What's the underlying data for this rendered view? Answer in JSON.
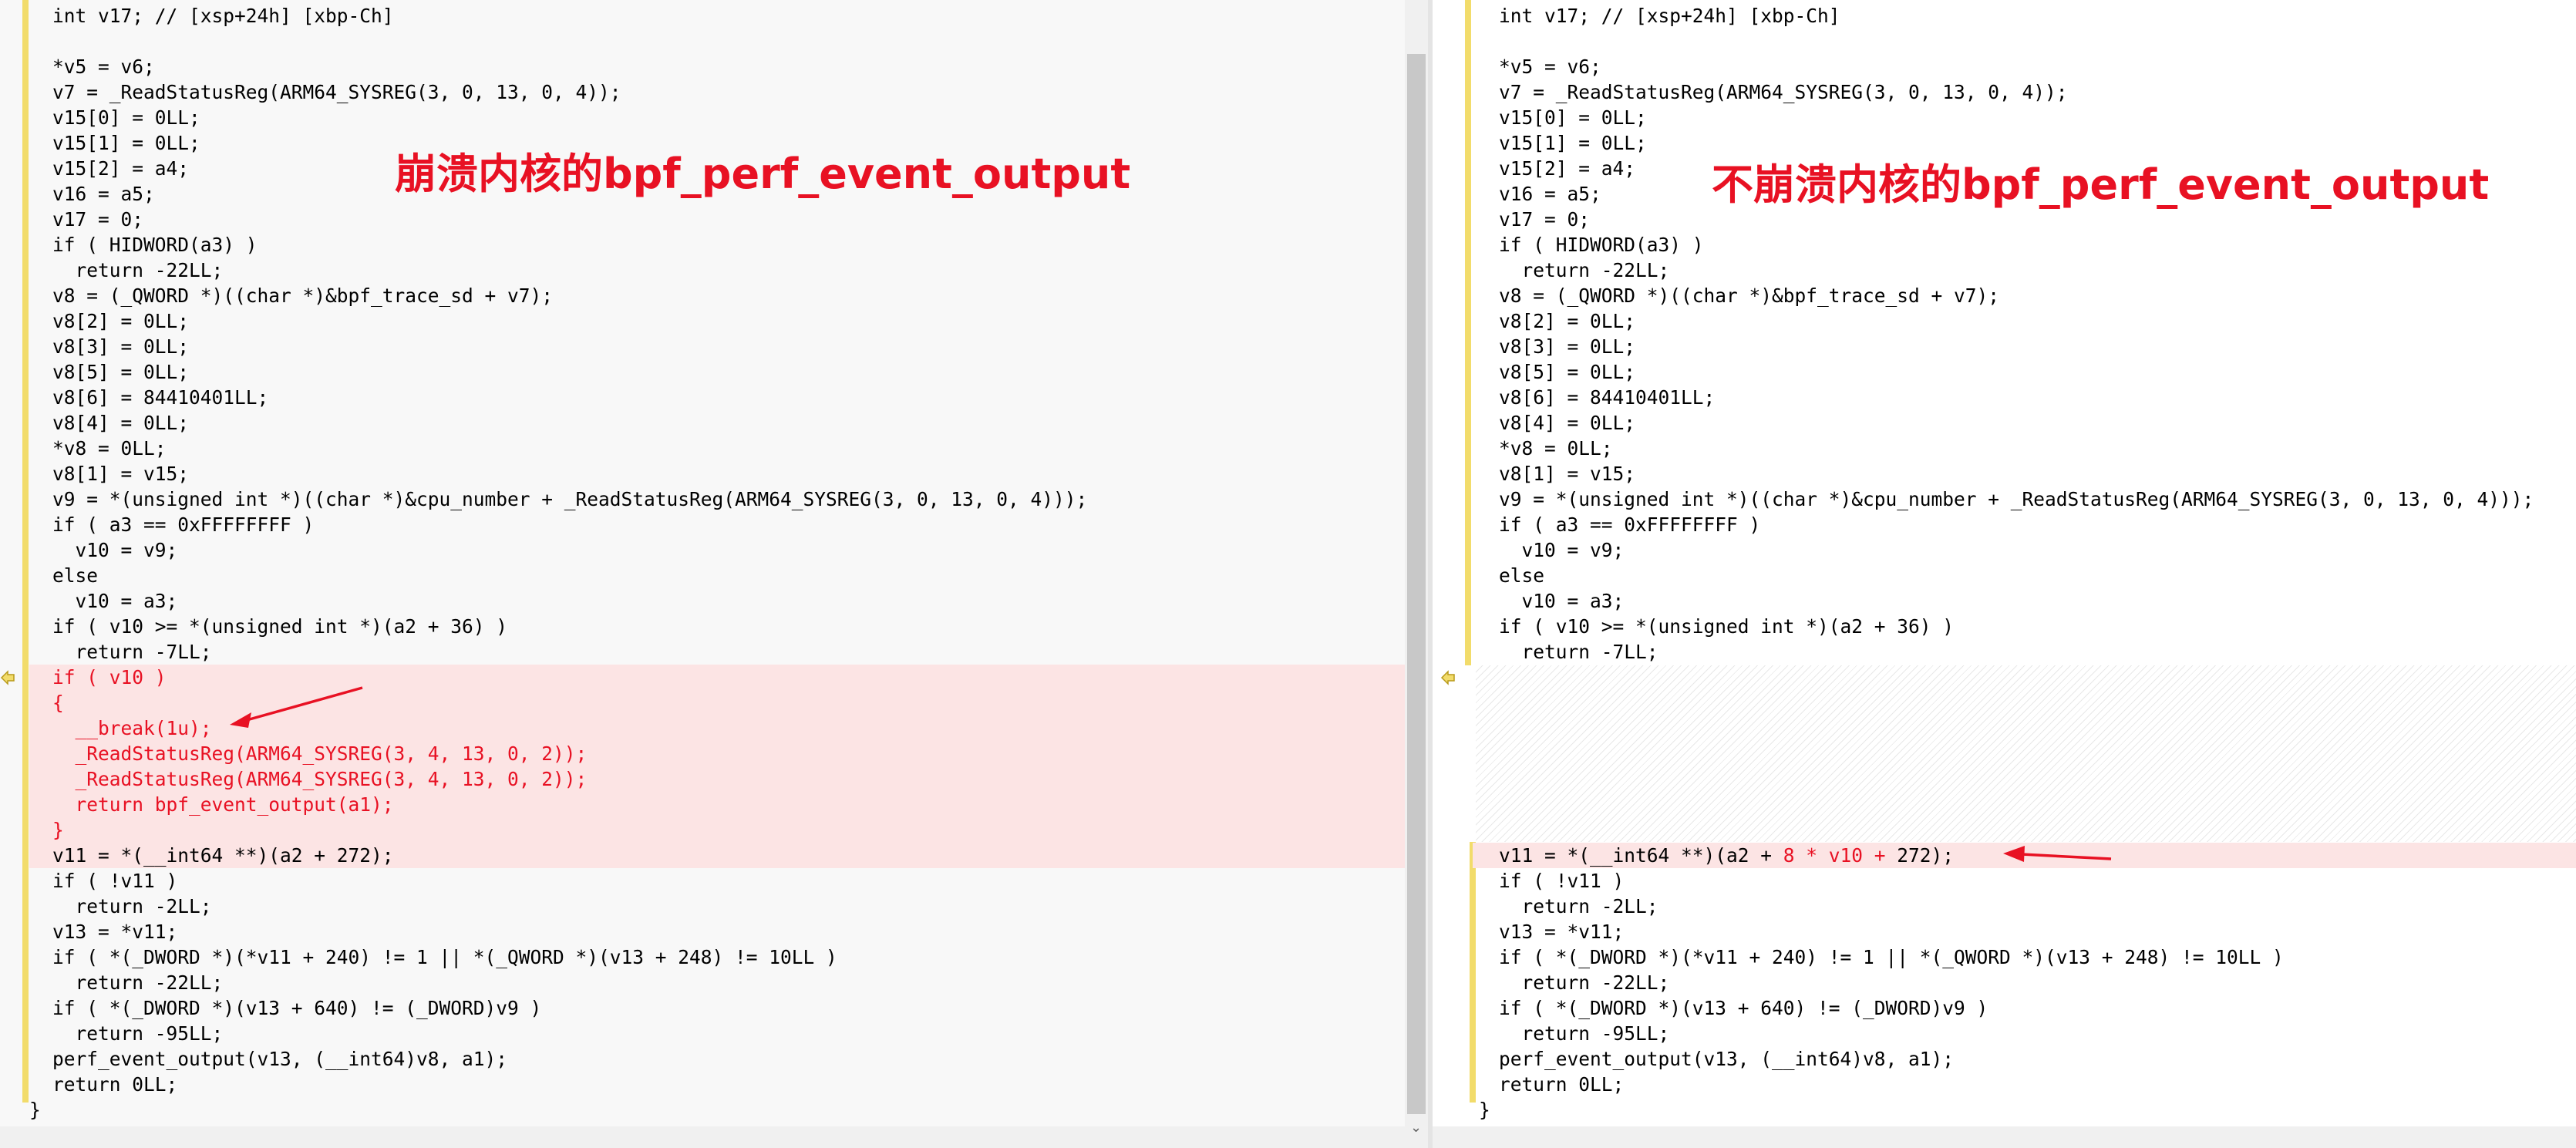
{
  "left_pane": {
    "annotation": "崩溃内核的bpf_perf_event_output",
    "lines": [
      {
        "text": "int v17; // [xsp+24h] [xbp-Ch]",
        "type": "normal"
      },
      {
        "text": "",
        "type": "normal"
      },
      {
        "text": "*v5 = v6;",
        "type": "normal"
      },
      {
        "text": "v7 = _ReadStatusReg(ARM64_SYSREG(3, 0, 13, 0, 4));",
        "type": "normal"
      },
      {
        "text": "v15[0] = 0LL;",
        "type": "normal"
      },
      {
        "text": "v15[1] = 0LL;",
        "type": "normal"
      },
      {
        "text": "v15[2] = a4;",
        "type": "normal"
      },
      {
        "text": "v16 = a5;",
        "type": "normal"
      },
      {
        "text": "v17 = 0;",
        "type": "normal"
      },
      {
        "text": "if ( HIDWORD(a3) )",
        "type": "normal"
      },
      {
        "text": "  return -22LL;",
        "type": "normal"
      },
      {
        "text": "v8 = (_QWORD *)((char *)&bpf_trace_sd + v7);",
        "type": "normal"
      },
      {
        "text": "v8[2] = 0LL;",
        "type": "normal"
      },
      {
        "text": "v8[3] = 0LL;",
        "type": "normal"
      },
      {
        "text": "v8[5] = 0LL;",
        "type": "normal"
      },
      {
        "text": "v8[6] = 84410401LL;",
        "type": "normal"
      },
      {
        "text": "v8[4] = 0LL;",
        "type": "normal"
      },
      {
        "text": "*v8 = 0LL;",
        "type": "normal"
      },
      {
        "text": "v8[1] = v15;",
        "type": "normal"
      },
      {
        "text": "v9 = *(unsigned int *)((char *)&cpu_number + _ReadStatusReg(ARM64_SYSREG(3, 0, 13, 0, 4)));",
        "type": "normal"
      },
      {
        "text": "if ( a3 == 0xFFFFFFFF )",
        "type": "normal"
      },
      {
        "text": "  v10 = v9;",
        "type": "normal"
      },
      {
        "text": "else",
        "type": "normal"
      },
      {
        "text": "  v10 = a3;",
        "type": "normal"
      },
      {
        "text": "if ( v10 >= *(unsigned int *)(a2 + 36) )",
        "type": "normal"
      },
      {
        "text": "  return -7LL;",
        "type": "normal"
      },
      {
        "text": "if ( v10 )",
        "type": "removed"
      },
      {
        "text": "{",
        "type": "removed"
      },
      {
        "text": "  __break(1u);",
        "type": "removed"
      },
      {
        "text": "  _ReadStatusReg(ARM64_SYSREG(3, 4, 13, 0, 2));",
        "type": "removed"
      },
      {
        "text": "  _ReadStatusReg(ARM64_SYSREG(3, 4, 13, 0, 2));",
        "type": "removed"
      },
      {
        "text": "  return bpf_event_output(a1);",
        "type": "removed"
      },
      {
        "text": "}",
        "type": "removed"
      },
      {
        "text": "v11 = *(__int64 **)(a2 + 272);",
        "type": "changed"
      },
      {
        "text": "if ( !v11 )",
        "type": "normal"
      },
      {
        "text": "  return -2LL;",
        "type": "normal"
      },
      {
        "text": "v13 = *v11;",
        "type": "normal"
      },
      {
        "text": "if ( *(_DWORD *)(*v11 + 240) != 1 || *(_QWORD *)(v13 + 248) != 10LL )",
        "type": "normal"
      },
      {
        "text": "  return -22LL;",
        "type": "normal"
      },
      {
        "text": "if ( *(_DWORD *)(v13 + 640) != (_DWORD)v9 )",
        "type": "normal"
      },
      {
        "text": "  return -95LL;",
        "type": "normal"
      },
      {
        "text": "perf_event_output(v13, (__int64)v8, a1);",
        "type": "normal"
      },
      {
        "text": "return 0LL;",
        "type": "normal"
      },
      {
        "text": "}",
        "type": "normal"
      }
    ]
  },
  "right_pane": {
    "annotation": "不崩溃内核的bpf_perf_event_output",
    "lines_top": [
      "int v17; // [xsp+24h] [xbp-Ch]",
      "",
      "*v5 = v6;",
      "v7 = _ReadStatusReg(ARM64_SYSREG(3, 0, 13, 0, 4));",
      "v15[0] = 0LL;",
      "v15[1] = 0LL;",
      "v15[2] = a4;",
      "v16 = a5;",
      "v17 = 0;",
      "if ( HIDWORD(a3) )",
      "  return -22LL;",
      "v8 = (_QWORD *)((char *)&bpf_trace_sd + v7);",
      "v8[2] = 0LL;",
      "v8[3] = 0LL;",
      "v8[5] = 0LL;",
      "v8[6] = 84410401LL;",
      "v8[4] = 0LL;",
      "*v8 = 0LL;",
      "v8[1] = v15;",
      "v9 = *(unsigned int *)((char *)&cpu_number + _ReadStatusReg(ARM64_SYSREG(3, 0, 13, 0, 4)));",
      "if ( a3 == 0xFFFFFFFF )",
      "  v10 = v9;",
      "else",
      "  v10 = a3;",
      "if ( v10 >= *(unsigned int *)(a2 + 36) )",
      "  return -7LL;"
    ],
    "changed_line": {
      "prefix": "v11 = *(__int64 **)(a2 + ",
      "highlight": "8 * v10 +",
      "suffix": " 272);"
    },
    "lines_bottom": [
      "if ( !v11 )",
      "  return -2LL;",
      "v13 = *v11;",
      "if ( *(_DWORD *)(*v11 + 240) != 1 || *(_QWORD *)(v13 + 248) != 10LL )",
      "  return -22LL;",
      "if ( *(_DWORD *)(v13 + 640) != (_DWORD)v9 )",
      "  return -95LL;",
      "perf_event_output(v13, (__int64)v8, a1);",
      "return 0LL;",
      "}"
    ]
  },
  "colors": {
    "removed_bg": "#fce4e4",
    "removed_text": "#e81123",
    "annotation": "#e81123",
    "change_bar": "#f2dc6b"
  },
  "icons": {
    "diff_marker": "diff-arrow-marker-icon",
    "scroll_down": "chevron-down-icon"
  }
}
